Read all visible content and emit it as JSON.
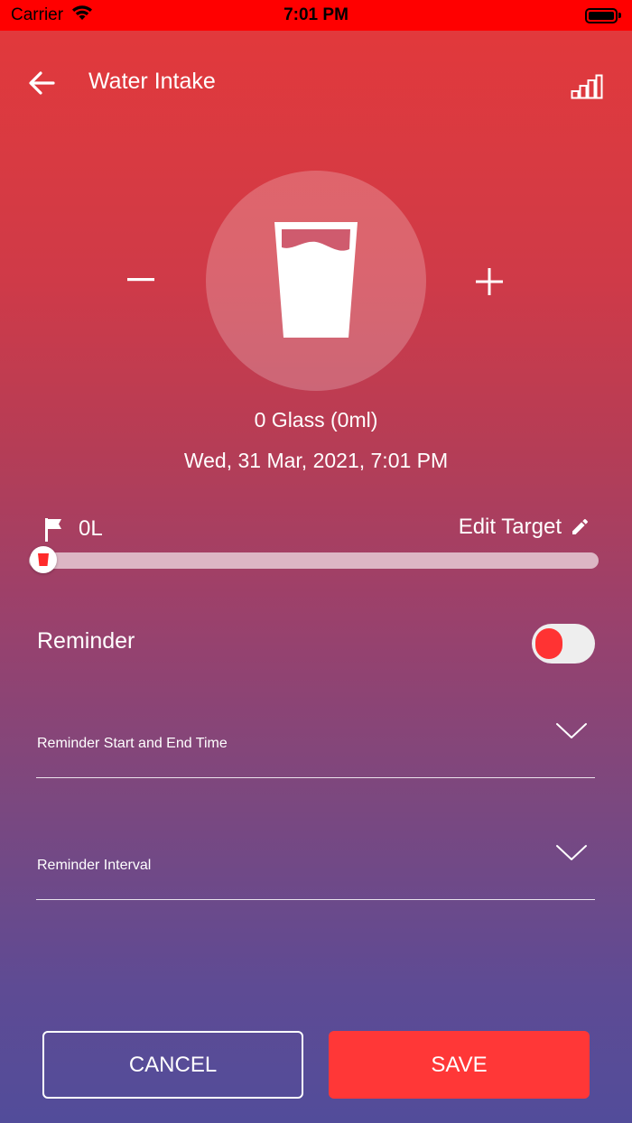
{
  "status_bar": {
    "carrier": "Carrier",
    "time": "7:01 PM"
  },
  "nav": {
    "title": "Water Intake",
    "back_icon": "arrow-left-icon",
    "stats_icon": "bar-chart-icon"
  },
  "counter": {
    "decrement_label": "−",
    "increment_label": "+",
    "glass_icon": "water-glass-icon",
    "count_text": "0 Glass (0ml)",
    "date_text": "Wed, 31 Mar, 2021, 7:01 PM"
  },
  "target": {
    "flag_icon": "flag-icon",
    "value": "0L",
    "edit_label": "Edit Target",
    "edit_icon": "pencil-icon",
    "progress": 0
  },
  "reminder": {
    "label": "Reminder",
    "enabled": false,
    "start_end_label": "Reminder Start and End Time",
    "interval_label": "Reminder Interval"
  },
  "actions": {
    "cancel_label": "CANCEL",
    "save_label": "SAVE"
  },
  "colors": {
    "accent": "#ff3737",
    "status_bar": "#ff0000",
    "gradient_top": "#e4393a",
    "gradient_bottom": "#524c9a"
  }
}
